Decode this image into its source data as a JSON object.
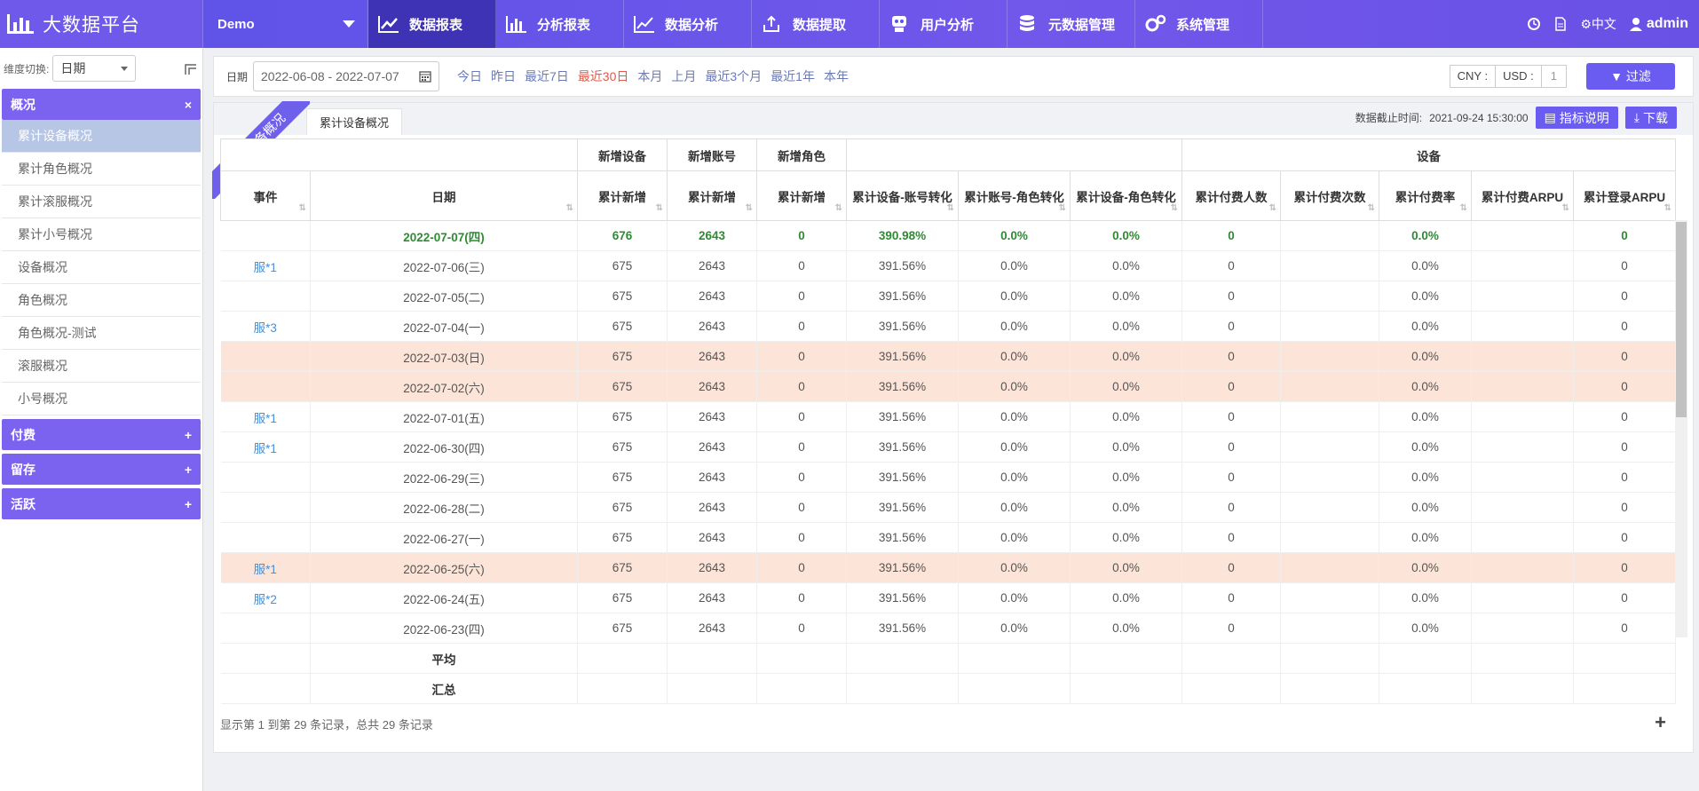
{
  "brand": {
    "title": "大数据平台"
  },
  "project": {
    "name": "Demo"
  },
  "nav": [
    {
      "label": "数据报表",
      "icon": "line-chart-icon",
      "active": true
    },
    {
      "label": "分析报表",
      "icon": "bar-chart-icon",
      "active": false
    },
    {
      "label": "数据分析",
      "icon": "trend-icon",
      "active": false
    },
    {
      "label": "数据提取",
      "icon": "upload-icon",
      "active": false
    },
    {
      "label": "用户分析",
      "icon": "user-analysis-icon",
      "active": false
    },
    {
      "label": "元数据管理",
      "icon": "database-icon",
      "active": false
    },
    {
      "label": "系统管理",
      "icon": "gears-icon",
      "active": false
    }
  ],
  "topright": {
    "lang": "中文",
    "user": "admin"
  },
  "sidebar": {
    "dim_label": "维度切换:",
    "dim_value": "日期",
    "groups": [
      {
        "label": "概况",
        "toggle": "×",
        "items": [
          "累计设备概况",
          "累计角色概况",
          "累计滚服概况",
          "累计小号概况",
          "设备概况",
          "角色概况",
          "角色概况-测试",
          "滚服概况",
          "小号概况"
        ]
      },
      {
        "label": "付费",
        "toggle": "+"
      },
      {
        "label": "留存",
        "toggle": "+"
      },
      {
        "label": "活跃",
        "toggle": "+"
      }
    ]
  },
  "filter": {
    "date_label": "日期",
    "date_range": "2022-06-08 - 2022-07-07",
    "quick": [
      "今日",
      "昨日",
      "最近7日",
      "最近30日",
      "本月",
      "上月",
      "最近3个月",
      "最近1年",
      "本年"
    ],
    "currency": [
      "CNY :",
      "USD :",
      "1"
    ],
    "filter_button": "过滤"
  },
  "panel": {
    "ribbon": "累计设备概况",
    "tab": "累计设备概况",
    "cutoff_label": "数据截止时间:",
    "cutoff_value": "2021-09-24 15:30:00",
    "btn_metrics": "指标说明",
    "btn_download": "下载"
  },
  "table": {
    "group_headers": [
      "新增设备",
      "新增账号",
      "新增角色",
      "设备"
    ],
    "columns": [
      "事件",
      "日期",
      "累计新增",
      "累计新增",
      "累计新增",
      "累计设备-账号转化",
      "累计账号-角色转化",
      "累计设备-角色转化",
      "累计付费人数",
      "累计付费次数",
      "累计付费率",
      "累计付费ARPU",
      "累计登录ARPU"
    ],
    "rows": [
      {
        "event": "",
        "date": "2022-07-07(四)",
        "v": [
          "676",
          "2643",
          "0",
          "390.98%",
          "0.0%",
          "0.0%",
          "0",
          "",
          "0.0%",
          "",
          "0"
        ],
        "hl": false
      },
      {
        "event": "服*1",
        "date": "2022-07-06(三)",
        "v": [
          "675",
          "2643",
          "0",
          "391.56%",
          "0.0%",
          "0.0%",
          "0",
          "",
          "0.0%",
          "",
          "0"
        ],
        "hl": false
      },
      {
        "event": "",
        "date": "2022-07-05(二)",
        "v": [
          "675",
          "2643",
          "0",
          "391.56%",
          "0.0%",
          "0.0%",
          "0",
          "",
          "0.0%",
          "",
          "0"
        ],
        "hl": false
      },
      {
        "event": "服*3",
        "date": "2022-07-04(一)",
        "v": [
          "675",
          "2643",
          "0",
          "391.56%",
          "0.0%",
          "0.0%",
          "0",
          "",
          "0.0%",
          "",
          "0"
        ],
        "hl": false
      },
      {
        "event": "",
        "date": "2022-07-03(日)",
        "v": [
          "675",
          "2643",
          "0",
          "391.56%",
          "0.0%",
          "0.0%",
          "0",
          "",
          "0.0%",
          "",
          "0"
        ],
        "hl": true
      },
      {
        "event": "",
        "date": "2022-07-02(六)",
        "v": [
          "675",
          "2643",
          "0",
          "391.56%",
          "0.0%",
          "0.0%",
          "0",
          "",
          "0.0%",
          "",
          "0"
        ],
        "hl": true
      },
      {
        "event": "服*1",
        "date": "2022-07-01(五)",
        "v": [
          "675",
          "2643",
          "0",
          "391.56%",
          "0.0%",
          "0.0%",
          "0",
          "",
          "0.0%",
          "",
          "0"
        ],
        "hl": false
      },
      {
        "event": "服*1",
        "date": "2022-06-30(四)",
        "v": [
          "675",
          "2643",
          "0",
          "391.56%",
          "0.0%",
          "0.0%",
          "0",
          "",
          "0.0%",
          "",
          "0"
        ],
        "hl": false
      },
      {
        "event": "",
        "date": "2022-06-29(三)",
        "v": [
          "675",
          "2643",
          "0",
          "391.56%",
          "0.0%",
          "0.0%",
          "0",
          "",
          "0.0%",
          "",
          "0"
        ],
        "hl": false
      },
      {
        "event": "",
        "date": "2022-06-28(二)",
        "v": [
          "675",
          "2643",
          "0",
          "391.56%",
          "0.0%",
          "0.0%",
          "0",
          "",
          "0.0%",
          "",
          "0"
        ],
        "hl": false
      },
      {
        "event": "",
        "date": "2022-06-27(一)",
        "v": [
          "675",
          "2643",
          "0",
          "391.56%",
          "0.0%",
          "0.0%",
          "0",
          "",
          "0.0%",
          "",
          "0"
        ],
        "hl": false
      },
      {
        "event": "服*1",
        "date": "2022-06-25(六)",
        "v": [
          "675",
          "2643",
          "0",
          "391.56%",
          "0.0%",
          "0.0%",
          "0",
          "",
          "0.0%",
          "",
          "0"
        ],
        "hl": true
      },
      {
        "event": "服*2",
        "date": "2022-06-24(五)",
        "v": [
          "675",
          "2643",
          "0",
          "391.56%",
          "0.0%",
          "0.0%",
          "0",
          "",
          "0.0%",
          "",
          "0"
        ],
        "hl": false
      },
      {
        "event": "",
        "date": "2022-06-23(四)",
        "v": [
          "675",
          "2643",
          "0",
          "391.56%",
          "0.0%",
          "0.0%",
          "0",
          "",
          "0.0%",
          "",
          "0"
        ],
        "hl": false
      }
    ],
    "footer": [
      "平均",
      "汇总"
    ]
  },
  "pager": "显示第 1 到第 29 条记录，总共 29 条记录"
}
